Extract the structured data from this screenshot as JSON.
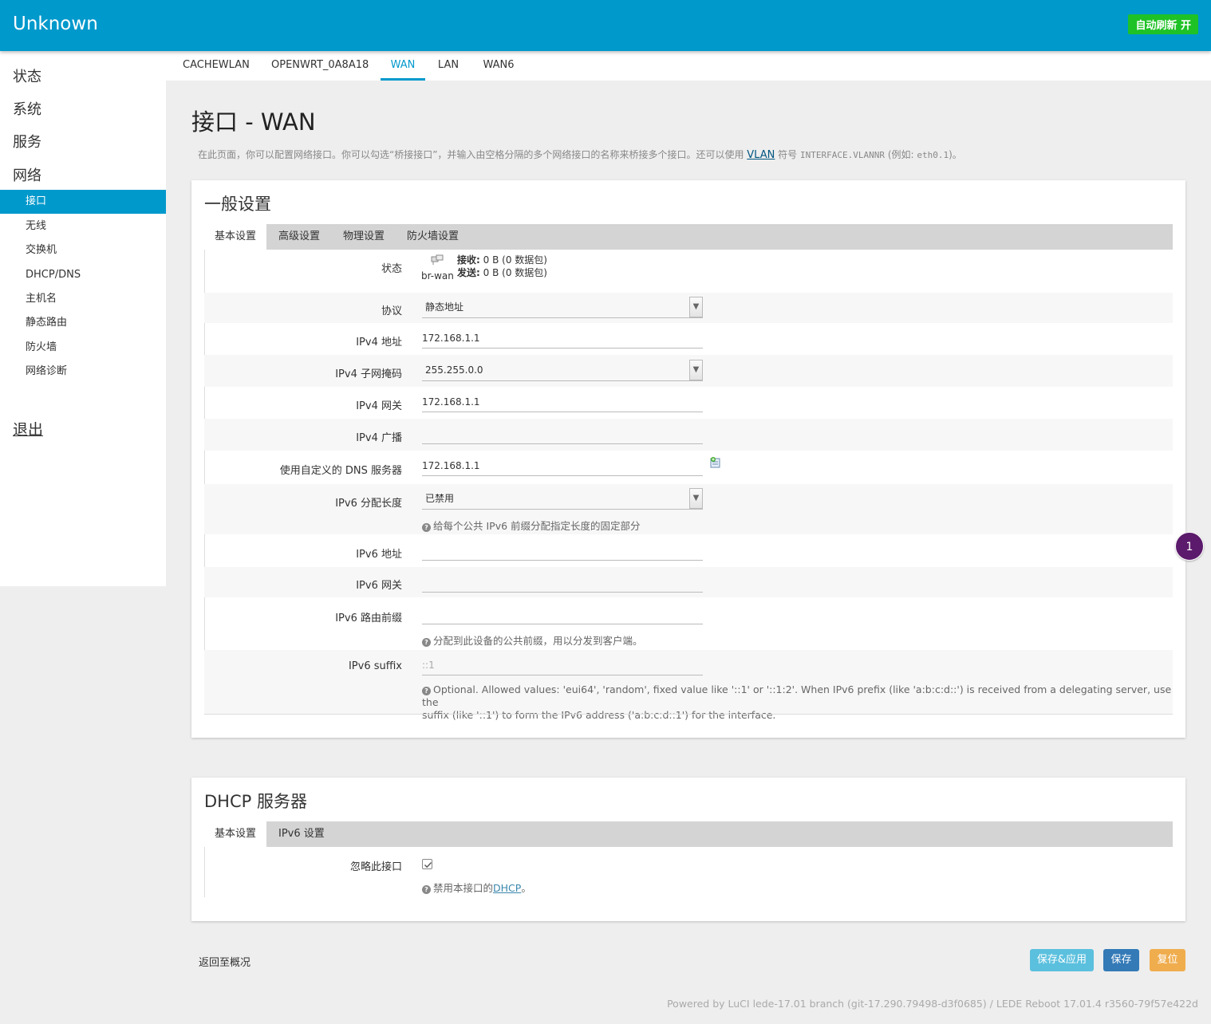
{
  "header": {
    "brand": "Unknown",
    "refresh": "自动刷新 开"
  },
  "sidebar": {
    "top": [
      "状态",
      "系统",
      "服务",
      "网络"
    ],
    "sub": [
      "接口",
      "无线",
      "交换机",
      "DHCP/DNS",
      "主机名",
      "静态路由",
      "防火墙",
      "网络诊断"
    ],
    "active_sub": "接口",
    "logout": "退出"
  },
  "iface_tabs": [
    "CACHEWLAN",
    "OPENWRT_0A8A18",
    "WAN",
    "LAN",
    "WAN6"
  ],
  "active_iface_tab": "WAN",
  "page": {
    "title": "接口 - WAN",
    "desc_pre": "在此页面，你可以配置网络接口。你可以勾选“桥接接口”，并输入由空格分隔的多个网络接口的名称来桥接多个接口。还可以使用",
    "desc_link": "VLAN",
    "desc_mid": "符号",
    "desc_mono": "INTERFACE.VLANNR",
    "desc_post": "(例如:",
    "desc_example": "eth0.1",
    "desc_end": ")。"
  },
  "general": {
    "title": "一般设置",
    "tabs": [
      "基本设置",
      "高级设置",
      "物理设置",
      "防火墙设置"
    ],
    "status": {
      "label": "状态",
      "ifname": "br-wan",
      "rx_label": "接收:",
      "rx_value": "0 B (0 数据包)",
      "tx_label": "发送:",
      "tx_value": "0 B (0 数据包)"
    },
    "protocol": {
      "label": "协议",
      "value": "静态地址"
    },
    "ipv4_addr": {
      "label": "IPv4 地址",
      "value": "172.168.1.1"
    },
    "ipv4_mask": {
      "label": "IPv4 子网掩码",
      "value": "255.255.0.0"
    },
    "ipv4_gw": {
      "label": "IPv4 网关",
      "value": "172.168.1.1"
    },
    "ipv4_bcast": {
      "label": "IPv4 广播",
      "value": ""
    },
    "dns": {
      "label": "使用自定义的 DNS 服务器",
      "value": "172.168.1.1"
    },
    "ipv6_assign": {
      "label": "IPv6 分配长度",
      "value": "已禁用",
      "hint": "给每个公共 IPv6 前缀分配指定长度的固定部分"
    },
    "ipv6_addr": {
      "label": "IPv6 地址",
      "value": ""
    },
    "ipv6_gw": {
      "label": "IPv6 网关",
      "value": ""
    },
    "ipv6_prefix": {
      "label": "IPv6 路由前缀",
      "value": "",
      "hint": "分配到此设备的公共前缀，用以分发到客户端。"
    },
    "ipv6_suffix": {
      "label": "IPv6 suffix",
      "placeholder": "::1",
      "hint1": "Optional. Allowed values: 'eui64', 'random', fixed value like '::1' or '::1:2'. When IPv6 prefix (like 'a:b:c:d::') is received from a delegating server, use the",
      "hint2": "suffix (like '::1') to form the IPv6 address ('a:b:c:d::1') for the interface."
    }
  },
  "dhcp": {
    "title": "DHCP 服务器",
    "tabs": [
      "基本设置",
      "IPv6 设置"
    ],
    "ignore": {
      "label": "忽略此接口",
      "checked": true,
      "hint_pre": "禁用本接口的",
      "hint_link": "DHCP",
      "hint_post": "。"
    }
  },
  "badge": "1",
  "actions": {
    "back": "返回至概况",
    "apply": "保存&应用",
    "save": "保存",
    "reset": "复位"
  },
  "footer": "Powered by LuCI lede-17.01 branch (git-17.290.79498-d3f0685) / LEDE Reboot 17.01.4 r3560-79f57e422d",
  "colors": {
    "primary": "#0099cc",
    "refresh": "#1ec226",
    "apply": "#5bc0de",
    "save": "#337ab7",
    "reset": "#f0ad4e",
    "badge": "#5b1a6b"
  }
}
